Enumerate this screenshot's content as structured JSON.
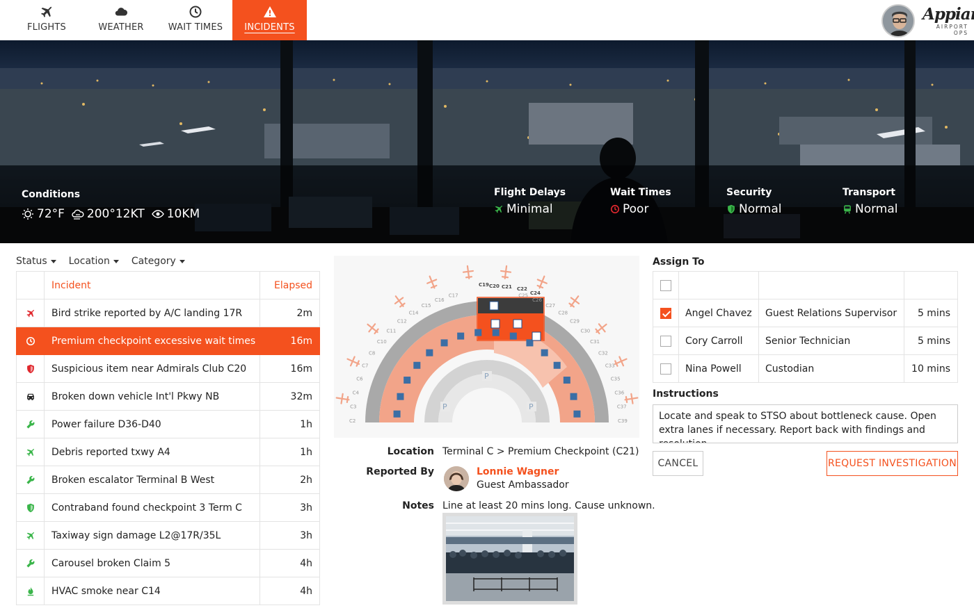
{
  "nav": {
    "tabs": [
      {
        "label": "FLIGHTS",
        "icon": "plane-icon"
      },
      {
        "label": "WEATHER",
        "icon": "cloud-icon"
      },
      {
        "label": "WAIT TIMES",
        "icon": "clock-icon"
      },
      {
        "label": "INCIDENTS",
        "icon": "warning-icon",
        "active": true
      }
    ],
    "brand": {
      "name": "Appian",
      "tagline": "AIRPORT OPS"
    }
  },
  "colors": {
    "accent": "#f4511e",
    "ok": "#3ab54a",
    "alert": "#e0282e"
  },
  "conditions": {
    "title": "Conditions",
    "temp": "72°F",
    "wind": "200°12KT",
    "visibility": "10KM"
  },
  "status": [
    {
      "title": "Flight Delays",
      "value": "Minimal",
      "icon": "plane-icon",
      "color": "#3ab54a"
    },
    {
      "title": "Wait Times",
      "value": "Poor",
      "icon": "clock-icon",
      "color": "#e0282e"
    },
    {
      "title": "Security",
      "value": "Normal",
      "icon": "shield-icon",
      "color": "#3ab54a"
    },
    {
      "title": "Transport",
      "value": "Normal",
      "icon": "train-icon",
      "color": "#3ab54a"
    }
  ],
  "filters": [
    "Status",
    "Location",
    "Category"
  ],
  "incidents": {
    "headers": {
      "incident": "Incident",
      "elapsed": "Elapsed"
    },
    "rows": [
      {
        "icon": "plane-icon",
        "color": "#e0282e",
        "name": "Bird strike reported by A/C landing 17R",
        "elapsed": "2m"
      },
      {
        "icon": "clock-icon",
        "color": "#e0282e",
        "name": "Premium checkpoint excessive wait times",
        "elapsed": "16m",
        "selected": true
      },
      {
        "icon": "shield-icon",
        "color": "#e0282e",
        "name": "Suspicious item near Admirals Club C20",
        "elapsed": "16m"
      },
      {
        "icon": "car-icon",
        "color": "#222222",
        "name": "Broken down vehicle Int'l Pkwy NB",
        "elapsed": "32m"
      },
      {
        "icon": "wrench-icon",
        "color": "#3ab54a",
        "name": "Power failure D36-D40",
        "elapsed": "1h"
      },
      {
        "icon": "plane-icon",
        "color": "#3ab54a",
        "name": "Debris reported txwy A4",
        "elapsed": "1h"
      },
      {
        "icon": "wrench-icon",
        "color": "#3ab54a",
        "name": "Broken escalator Terminal B West",
        "elapsed": "2h"
      },
      {
        "icon": "shield-icon",
        "color": "#3ab54a",
        "name": "Contraband found checkpoint 3 Term C",
        "elapsed": "3h"
      },
      {
        "icon": "plane-icon",
        "color": "#3ab54a",
        "name": "Taxiway sign damage L2@17R/35L",
        "elapsed": "3h"
      },
      {
        "icon": "wrench-icon",
        "color": "#3ab54a",
        "name": "Carousel broken Claim 5",
        "elapsed": "4h"
      },
      {
        "icon": "fire-icon",
        "color": "#3ab54a",
        "name": "HVAC smoke near C14",
        "elapsed": "4h"
      }
    ]
  },
  "map": {
    "gates_left": [
      "C2",
      "C3",
      "C4",
      "C6",
      "C7",
      "C8",
      "C10",
      "C11",
      "C12",
      "C14",
      "C15",
      "C16",
      "C17"
    ],
    "gates_top": [
      "C19",
      "C20",
      "C21",
      "C22",
      "C24"
    ],
    "gates_right": [
      "C25",
      "C26",
      "C27",
      "C28",
      "C29",
      "C30",
      "C31",
      "C32",
      "C33",
      "C35",
      "C36",
      "C37",
      "C39"
    ],
    "parking_label": "P"
  },
  "details": {
    "location_label": "Location",
    "location": "Terminal C > Premium Checkpoint (C21)",
    "reported_by_label": "Reported By",
    "reporter_name": "Lonnie Wagner",
    "reporter_role": "Guest Ambassador",
    "notes_label": "Notes",
    "notes": "Line at least 20 mins long. Cause unknown."
  },
  "assign": {
    "title": "Assign To",
    "rows": [
      {
        "checked": true,
        "name": "Angel Chavez",
        "role": "Guest Relations Supervisor",
        "time": "5 mins"
      },
      {
        "checked": false,
        "name": "Cory Carroll",
        "role": "Senior Technician",
        "time": "5 mins"
      },
      {
        "checked": false,
        "name": "Nina Powell",
        "role": "Custodian",
        "time": "10 mins"
      }
    ]
  },
  "instructions": {
    "title": "Instructions",
    "text": "Locate and speak to STSO about bottleneck cause. Open extra lanes if necessary. Report back with findings and resolution."
  },
  "buttons": {
    "cancel": "CANCEL",
    "request": "REQUEST INVESTIGATION"
  }
}
